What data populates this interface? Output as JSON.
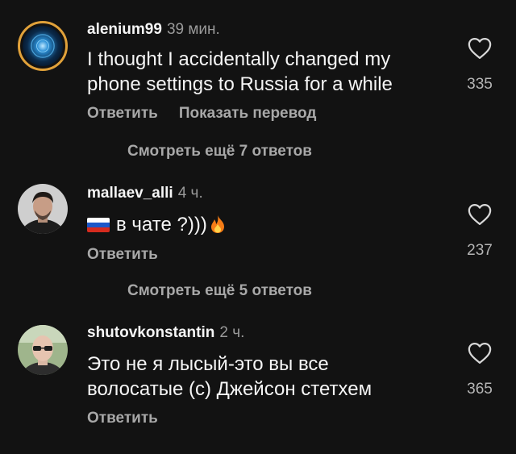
{
  "comments": [
    {
      "username": "alenium99",
      "time": "39 мин.",
      "text": "I thought I accidentally changed my phone settings to Russia for a while",
      "reply_label": "Ответить",
      "translate_label": "Показать перевод",
      "likes": "335",
      "avatar": "blue-orb-avatar"
    },
    {
      "username": "mallaev_alli",
      "time": "4 ч.",
      "text": "в чате ?)))",
      "text_prefix_icon": "russia-flag-icon",
      "text_suffix_icon": "fire-icon",
      "reply_label": "Ответить",
      "likes": "237",
      "avatar": "man-portrait-avatar"
    },
    {
      "username": "shutovkonstantin",
      "time": "2 ч.",
      "text_line1": "Это не я лысый-это вы все",
      "text_line2": "волосатые (с) Джейсон стетхем",
      "reply_label": "Ответить",
      "likes": "365",
      "avatar": "bald-man-avatar"
    }
  ],
  "more_replies": [
    "Смотреть ещё 7 ответов",
    "Смотреть ещё 5 ответов"
  ],
  "colors": {
    "background": "#121212",
    "primary_text": "#f5f5f5",
    "secondary_text": "#a8a8a8",
    "story_ring": "#e0a13a"
  }
}
